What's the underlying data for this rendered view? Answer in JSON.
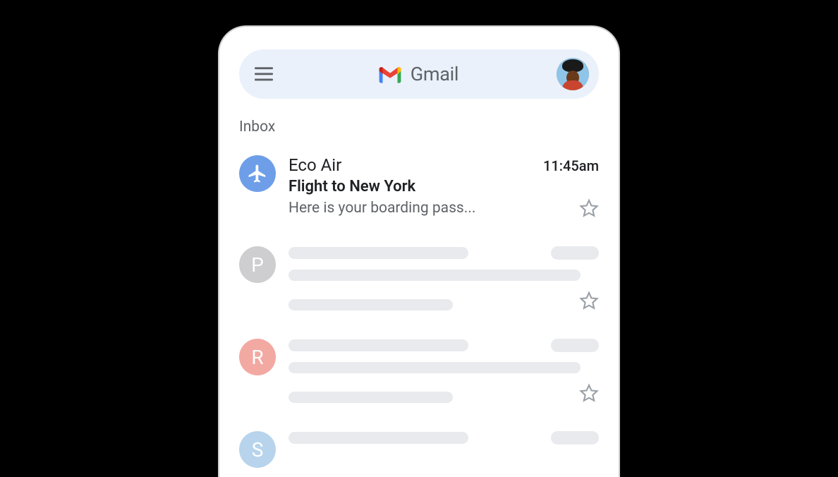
{
  "header": {
    "brand_label": "Gmail"
  },
  "section": {
    "label": "Inbox"
  },
  "emails": [
    {
      "sender": "Eco Air",
      "time": "11:45am",
      "subject": "Flight to New York",
      "preview": "Here is your boarding pass...",
      "avatar_icon": "airplane",
      "avatar_color": "blue",
      "starred": false
    }
  ],
  "placeholder_emails": [
    {
      "avatar_letter": "P",
      "avatar_color": "grey",
      "starred": false
    },
    {
      "avatar_letter": "R",
      "avatar_color": "red",
      "starred": false
    },
    {
      "avatar_letter": "S",
      "avatar_color": "lightblue",
      "starred": false
    }
  ]
}
